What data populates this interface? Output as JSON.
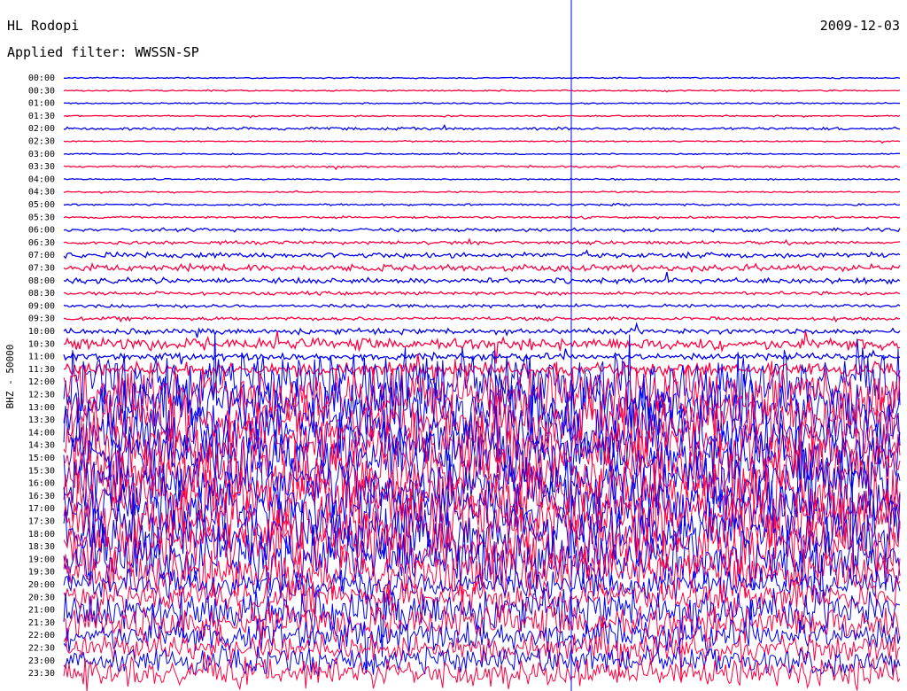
{
  "header": {
    "station": "HL Rodopi",
    "date": "2009-12-03",
    "filter_label": "Applied filter:",
    "filter_value": "WWSSN-SP"
  },
  "chart_data": {
    "type": "line",
    "title": "HL Rodopi",
    "ylabel": "BHZ - 50000",
    "row_interval_minutes": 30,
    "rows": [
      "00:00",
      "00:30",
      "01:00",
      "01:30",
      "02:00",
      "02:30",
      "03:00",
      "03:30",
      "04:00",
      "04:30",
      "05:00",
      "05:30",
      "06:00",
      "06:30",
      "07:00",
      "07:30",
      "08:00",
      "08:30",
      "09:00",
      "09:30",
      "10:00",
      "10:30",
      "11:00",
      "11:30",
      "12:00",
      "12:30",
      "13:00",
      "13:30",
      "14:00",
      "14:30",
      "15:00",
      "15:30",
      "16:00",
      "16:30",
      "17:00",
      "17:30",
      "18:00",
      "18:30",
      "19:00",
      "19:30",
      "20:00",
      "20:30",
      "21:00",
      "21:30",
      "22:00",
      "22:30",
      "23:00",
      "23:30"
    ],
    "row_colors": [
      "#0000ee",
      "#ff0040"
    ],
    "marker_line_color": "#0000ee",
    "activity_by_row": [
      0.02,
      0.02,
      0.02,
      0.02,
      0.04,
      0.02,
      0.02,
      0.03,
      0.02,
      0.02,
      0.03,
      0.03,
      0.05,
      0.05,
      0.08,
      0.1,
      0.08,
      0.05,
      0.05,
      0.05,
      0.08,
      0.18,
      0.1,
      0.2,
      0.9,
      0.9,
      0.9,
      0.9,
      0.9,
      0.9,
      0.9,
      0.9,
      0.9,
      0.9,
      0.9,
      0.9,
      0.9,
      0.9,
      0.9,
      0.7,
      0.45,
      0.5,
      0.6,
      0.55,
      0.45,
      0.4,
      0.4,
      0.45
    ],
    "grid": false
  },
  "icons": {}
}
